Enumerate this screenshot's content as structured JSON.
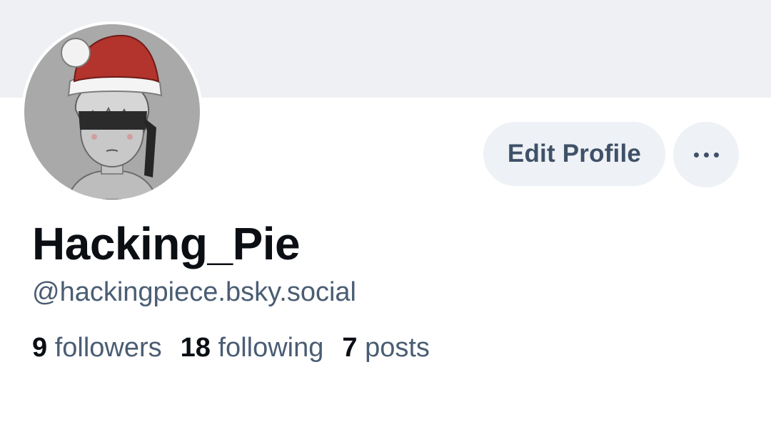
{
  "profile": {
    "display_name": "Hacking_Pie",
    "handle": "@hackingpiece.bsky.social",
    "avatar_icon": "avatar-santa-hat-blindfold"
  },
  "actions": {
    "edit_label": "Edit Profile",
    "more_icon": "more-horizontal-icon"
  },
  "stats": {
    "followers": {
      "count": "9",
      "label": "followers"
    },
    "following": {
      "count": "18",
      "label": "following"
    },
    "posts": {
      "count": "7",
      "label": "posts"
    }
  },
  "colors": {
    "banner": "#eef0f3",
    "button_bg": "#eef1f5",
    "button_text": "#3f5168",
    "name_text": "#0b0f14",
    "secondary_text": "#4a5d73"
  }
}
